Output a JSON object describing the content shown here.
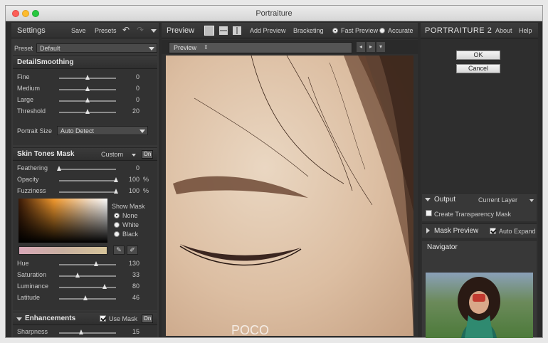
{
  "window": {
    "title": "Portraiture"
  },
  "left": {
    "header": {
      "title": "Settings",
      "save": "Save",
      "presets": "Presets",
      "undo_icon": "undo-icon",
      "redo_icon": "redo-icon"
    },
    "preset": {
      "label": "Preset",
      "value": "Default"
    },
    "detail": {
      "title": "DetailSmoothing",
      "sliders": [
        {
          "label": "Fine",
          "value": "0",
          "level": 0.5
        },
        {
          "label": "Medium",
          "value": "0",
          "level": 0.5
        },
        {
          "label": "Large",
          "value": "0",
          "level": 0.5
        },
        {
          "label": "Threshold",
          "value": "20",
          "level": 0.5
        }
      ],
      "portrait_size": {
        "label": "Portrait Size",
        "value": "Auto Detect"
      }
    },
    "skin": {
      "title": "Skin Tones Mask",
      "mode": "Custom",
      "on": "On",
      "sliders": [
        {
          "label": "Feathering",
          "value": "0",
          "unit": "",
          "level": 0.0
        },
        {
          "label": "Opacity",
          "value": "100",
          "unit": "%",
          "level": 1.0
        },
        {
          "label": "Fuzziness",
          "value": "100",
          "unit": "%",
          "level": 1.0
        }
      ],
      "show_mask": {
        "label": "Show Mask",
        "options": [
          "None",
          "White",
          "Black"
        ],
        "selected": 0
      },
      "hsl": [
        {
          "label": "Hue",
          "value": "130",
          "level": 0.65
        },
        {
          "label": "Saturation",
          "value": "33",
          "level": 0.33
        },
        {
          "label": "Luminance",
          "value": "80",
          "level": 0.8
        },
        {
          "label": "Latitude",
          "value": "46",
          "level": 0.46
        }
      ]
    },
    "enh": {
      "title": "Enhancements",
      "use_mask": "Use Mask",
      "on": "On",
      "sharpness": {
        "label": "Sharpness",
        "value": "15",
        "level": 0.4
      }
    }
  },
  "center": {
    "header": {
      "title": "Preview",
      "add_preview": "Add Preview",
      "bracketing": "Bracketing",
      "fast_preview": "Fast Preview",
      "accurate": "Accurate"
    },
    "tab": {
      "label": "Preview"
    },
    "watermark": "POCO"
  },
  "right": {
    "brand": "PORTRAITURE 2",
    "about": "About",
    "help": "Help",
    "ok": "OK",
    "cancel": "Cancel",
    "output": {
      "label": "Output",
      "value": "Current Layer",
      "transparency": "Create Transparency Mask"
    },
    "mask_preview": {
      "label": "Mask Preview",
      "auto_expand": "Auto Expand"
    },
    "navigator": {
      "label": "Navigator"
    }
  },
  "colors": {
    "panel": "#383838",
    "frame": "#2b2b2b",
    "accent": "#d6d6d6"
  }
}
